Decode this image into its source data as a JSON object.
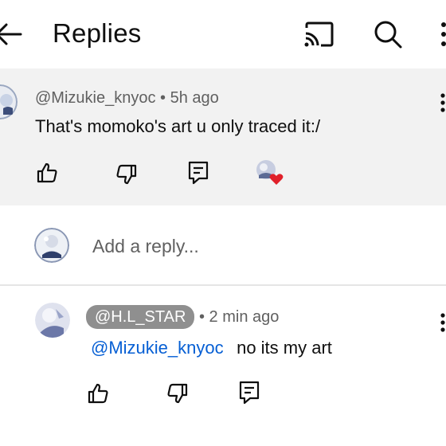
{
  "header": {
    "title": "Replies",
    "icons": [
      "back-arrow-icon",
      "cast-icon",
      "search-icon",
      "more-vert-icon"
    ]
  },
  "parent_comment": {
    "author": "@Mizukie_knyoc",
    "separator": "•",
    "time": "5h ago",
    "text": "That's momoko's art u only traced it:/",
    "actions": [
      "like-icon",
      "dislike-icon",
      "reply-icon",
      "creator-heart-icon"
    ]
  },
  "reply_box": {
    "placeholder": "Add a reply..."
  },
  "reply": {
    "author": "@H.L_STAR",
    "separator": "•",
    "time": "2 min ago",
    "mention": "@Mizukie_knyoc",
    "text": "no its my art",
    "actions": [
      "like-icon",
      "dislike-icon",
      "reply-icon"
    ]
  },
  "colors": {
    "background": "#ffffff",
    "highlight_bg": "#f2f2f2",
    "meta_text": "#606060",
    "mention": "#065fd4",
    "pill": "#8f8f8f",
    "heart": "#e0202a"
  }
}
